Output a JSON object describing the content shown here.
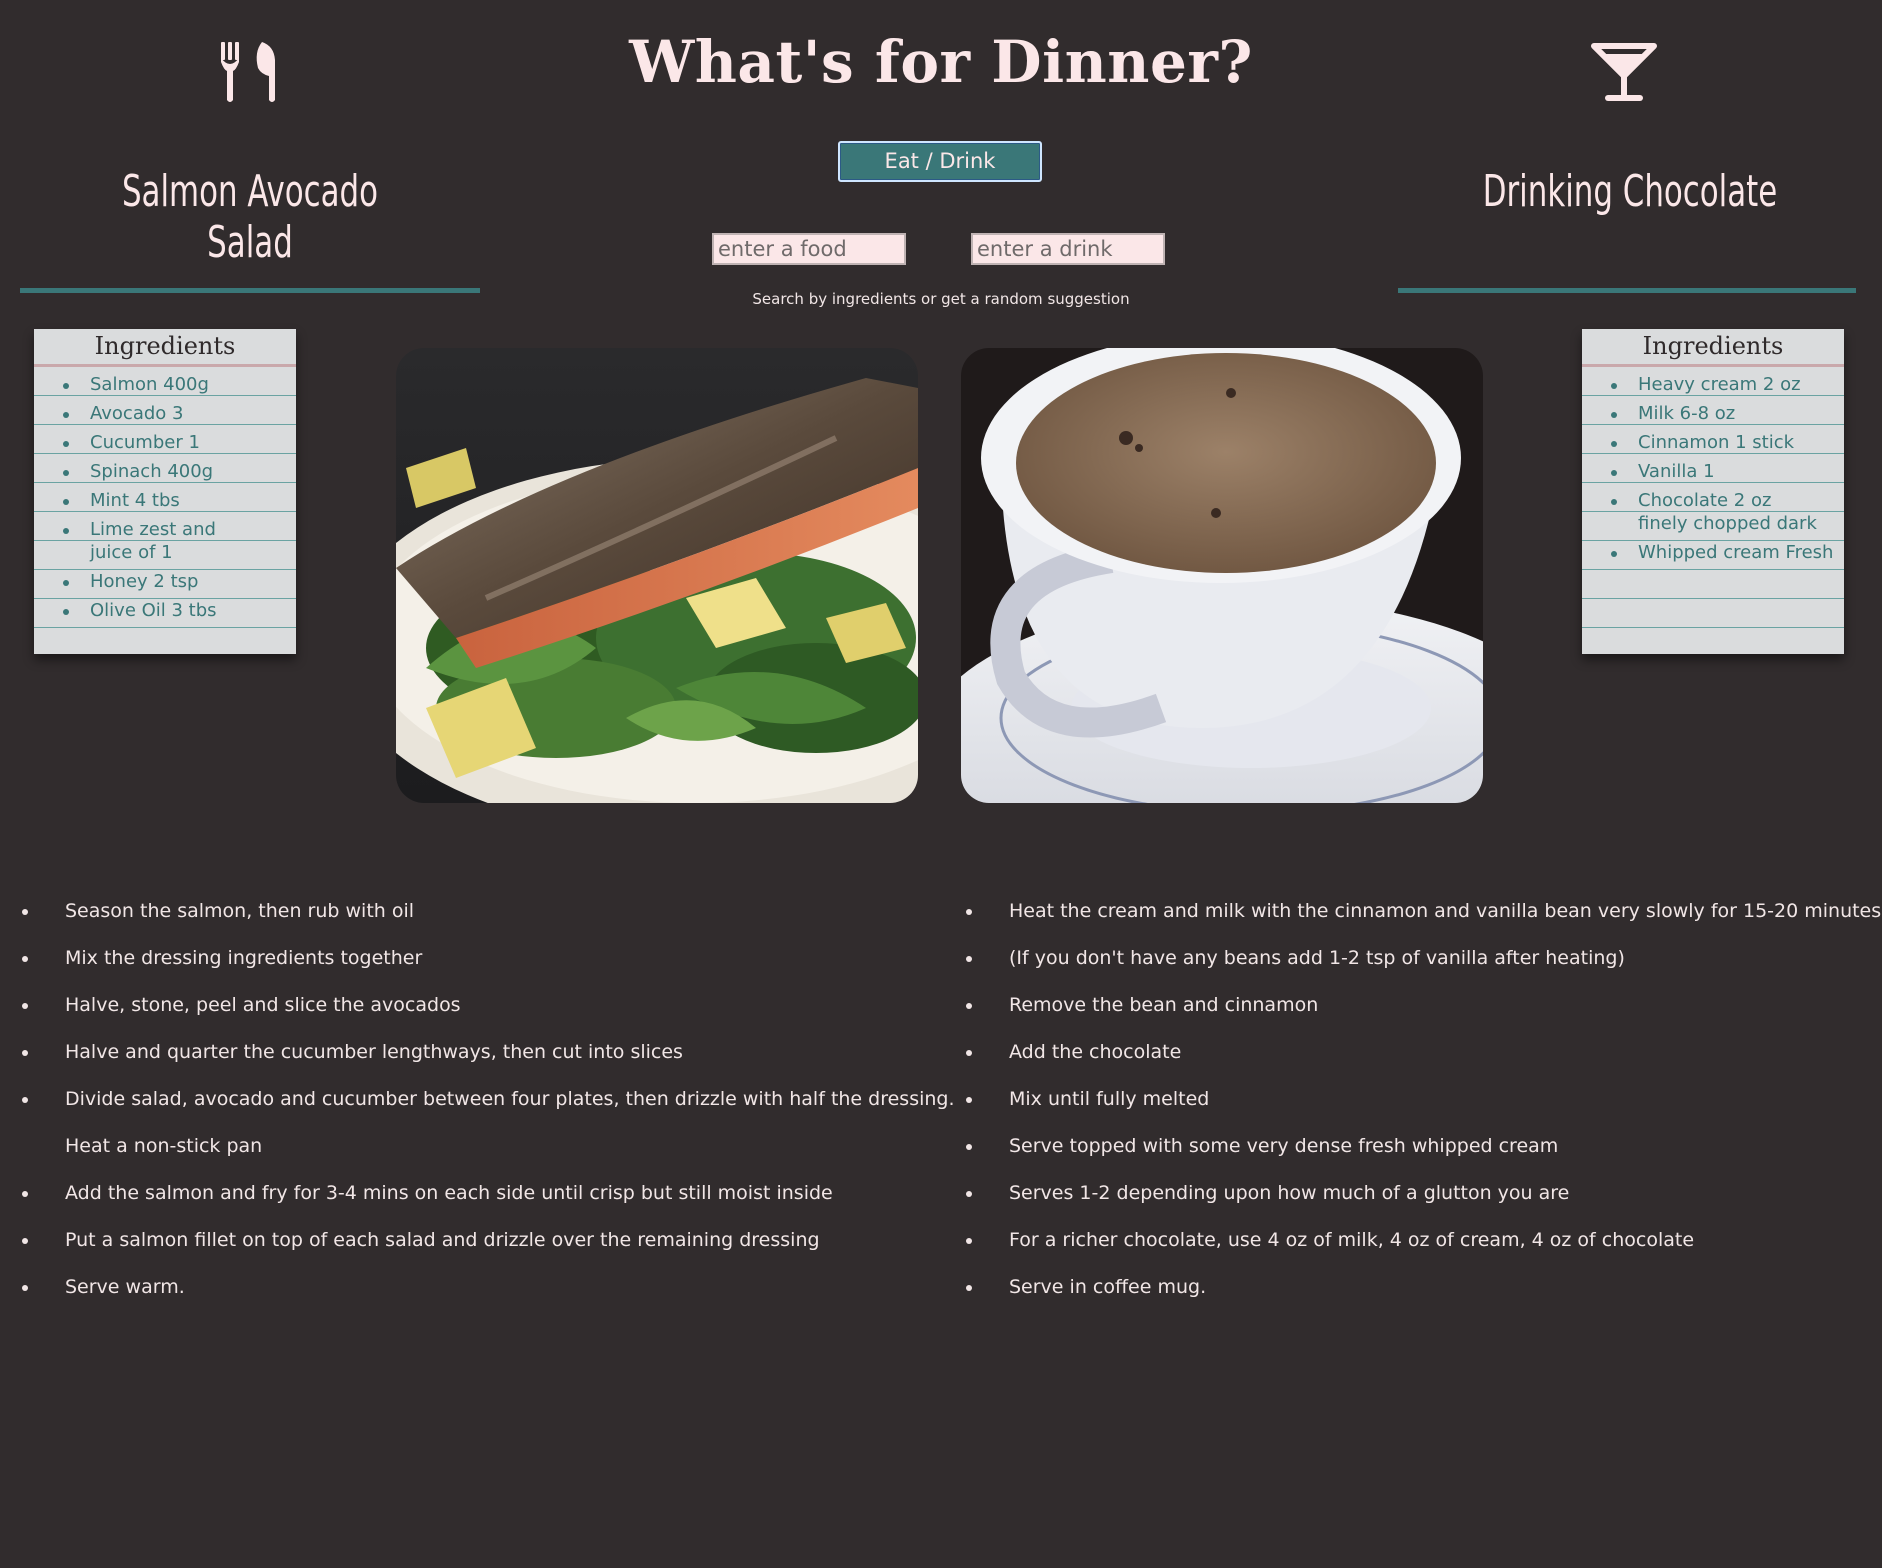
{
  "header": {
    "title": "What's for Dinner?",
    "toggle_label": "Eat / Drink",
    "food_placeholder": "enter a food",
    "drink_placeholder": "enter a drink",
    "hint": "Search by ingredients or get a random suggestion"
  },
  "icons": {
    "food": "fork-knife-icon",
    "drink": "cocktail-glass-icon"
  },
  "colors": {
    "background": "#312c2d",
    "accent": "#3a7778",
    "title": "#fbe7e8",
    "card": "#dadcdd"
  },
  "food": {
    "name": "Salmon Avocado Salad",
    "ingredients_title": "Ingredients",
    "ingredients": [
      "Salmon 400g",
      "Avocado 3",
      "Cucumber 1",
      "Spinach 400g",
      "Mint 4 tbs",
      "Lime zest and juice of 1",
      "Honey 2 tsp",
      "Olive Oil 3 tbs"
    ],
    "steps": [
      "Season the salmon, then rub with oil",
      "Mix the dressing ingredients together",
      "Halve, stone, peel and slice the avocados",
      "Halve and quarter the cucumber lengthways, then cut into slices",
      "Divide salad, avocado and cucumber between four plates, then drizzle with half the dressing.",
      "Heat a non-stick pan",
      "Add the salmon and fry for 3-4 mins on each side until crisp but still moist inside",
      "Put a salmon fillet on top of each salad and drizzle over the remaining dressing",
      "Serve warm."
    ]
  },
  "drink": {
    "name": "Drinking Chocolate",
    "ingredients_title": "Ingredients",
    "ingredients": [
      "Heavy cream 2 oz",
      "Milk 6-8 oz",
      "Cinnamon 1 stick",
      "Vanilla 1",
      "Chocolate 2 oz finely chopped dark",
      "Whipped cream Fresh"
    ],
    "steps": [
      "Heat the cream and milk with the cinnamon and vanilla bean very slowly for 15-20 minutes",
      "(If you don't have any beans add 1-2 tsp of vanilla after heating)",
      "Remove the bean and cinnamon",
      "Add the chocolate",
      "Mix until fully melted",
      "Serve topped with some very dense fresh whipped cream",
      "Serves 1-2 depending upon how much of a glutton you are",
      "For a richer chocolate, use 4 oz of milk, 4 oz of cream, 4 oz of chocolate",
      "Serve in coffee mug."
    ]
  }
}
